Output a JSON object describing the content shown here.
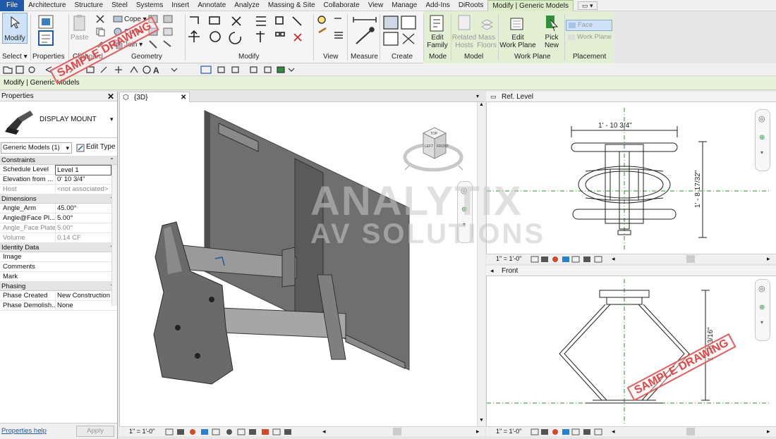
{
  "menu": {
    "tabs": [
      "File",
      "Architecture",
      "Structure",
      "Steel",
      "Systems",
      "Insert",
      "Annotate",
      "Analyze",
      "Massing & Site",
      "Collaborate",
      "View",
      "Manage",
      "Add-Ins",
      "DiRoots",
      "Modify | Generic Models"
    ]
  },
  "ribbon": {
    "modify_label": "Modify",
    "paste_label": "Paste",
    "cope_label": "Cope",
    "cut_label": "Cut",
    "join_label": "Join",
    "groups": {
      "select": "Select",
      "properties": "Properties",
      "clipboard": "Clipboard",
      "geometry": "Geometry",
      "modify": "Modify",
      "view": "View",
      "measure": "Measure",
      "create": "Create",
      "mode": "Mode",
      "model": "Model",
      "work_plane": "Work Plane",
      "placement": "Placement"
    },
    "edit_family": [
      "Edit",
      "Family"
    ],
    "related_hosts": [
      "Related",
      "Hosts"
    ],
    "mass_floors": [
      "Mass",
      "Floors"
    ],
    "edit_work_plane": [
      "Edit",
      "Work Plane"
    ],
    "pick_new": [
      "Pick",
      "New"
    ],
    "face_label": "Face",
    "work_plane_label": "Work Plane"
  },
  "options_bar": {
    "text": "Modify | Generic Models"
  },
  "properties": {
    "title": "Properties",
    "type_name": "DISPLAY MOUNT",
    "selector": "Generic Models (1)",
    "edit_type": "Edit Type",
    "categories": {
      "constraints": "Constraints",
      "dimensions": "Dimensions",
      "identity": "Identity Data",
      "phasing": "Phasing"
    },
    "rows": [
      {
        "k": "Schedule Level",
        "v": "Level 1"
      },
      {
        "k": "Elevation from ...",
        "v": "0'  10 3/4\""
      },
      {
        "k": "Host",
        "v": "<not associated>"
      },
      {
        "k": "Angle_Arm",
        "v": "45.00°"
      },
      {
        "k": "Angle@Face Pl...",
        "v": "5.00°"
      },
      {
        "k": "Angle_Face Plate",
        "v": "5.00°"
      },
      {
        "k": "Volume",
        "v": "0.14 CF"
      },
      {
        "k": "Image",
        "v": ""
      },
      {
        "k": "Comments",
        "v": ""
      },
      {
        "k": "Mark",
        "v": ""
      },
      {
        "k": "Phase Created",
        "v": "New Construction"
      },
      {
        "k": "Phase Demolish...",
        "v": "None"
      }
    ],
    "help_link": "Properties help",
    "apply": "Apply"
  },
  "views": {
    "view3d_title": "{3D}",
    "ref_level_title": "Ref. Level",
    "front_title": "Front",
    "scale": "1\" = 1'-0\""
  },
  "dimensions": {
    "width": "1' - 10 3/4\"",
    "depth": "1' - 8 17/32\"",
    "front_height": "1' - 8 3/16\""
  },
  "watermark": {
    "line1": "ANALYTIX",
    "line2": "AV SOLUTIONS",
    "stamp": "SAMPLE DRAWING"
  },
  "viewcube": {
    "top": "TOP",
    "left": "LEFT",
    "front": "FRONT"
  },
  "colors": {
    "file_tab": "#1e5aa8",
    "context_tab": "#ddecc9",
    "option_bar": "#e8f1da"
  }
}
